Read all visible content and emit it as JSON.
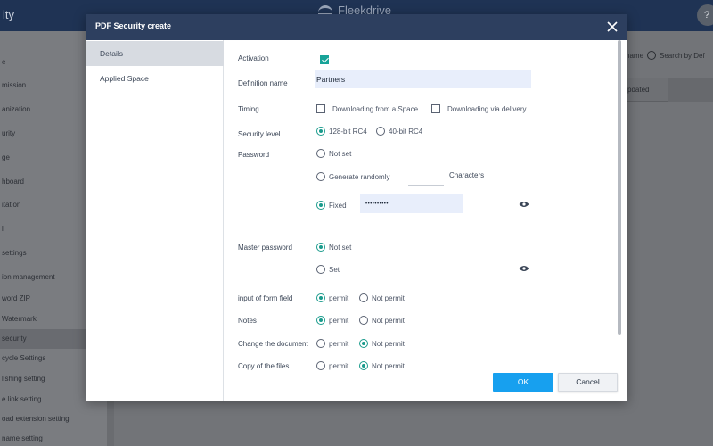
{
  "app": {
    "title_fragment": "ity",
    "logo_text": "Fleekdrive",
    "help_label": "?"
  },
  "sidebar": {
    "items": [
      {
        "label": "e"
      },
      {
        "label": "mission"
      },
      {
        "label": "anization"
      },
      {
        "label": "urity"
      },
      {
        "label": "ge"
      },
      {
        "label": "hboard"
      },
      {
        "label": "itation"
      },
      {
        "label": "l"
      },
      {
        "label": " settings"
      },
      {
        "label": "ion management"
      },
      {
        "label": "word ZIP"
      },
      {
        "label": "Watermark"
      },
      {
        "label": "security",
        "active": true
      },
      {
        "label": "cycle Settings"
      },
      {
        "label": "lishing setting"
      },
      {
        "label": "e link setting"
      },
      {
        "label": "oad extension setting"
      },
      {
        "label": " name setting"
      }
    ]
  },
  "background": {
    "search_option_1": "name",
    "search_option_2": "Search by Def",
    "column_header": "pdated"
  },
  "modal": {
    "title": "PDF Security create",
    "close_icon": "close-icon",
    "nav": [
      {
        "label": "Details",
        "active": true
      },
      {
        "label": "Applied Space",
        "active": false
      }
    ],
    "form": {
      "activation": {
        "label": "Activation",
        "checked": true
      },
      "definition_name": {
        "label": "Definition name",
        "value": "Partners"
      },
      "timing": {
        "label": "Timing",
        "options": [
          {
            "label": "Downloading from a Space",
            "checked": false
          },
          {
            "label": "Downloading via delivery",
            "checked": false
          }
        ]
      },
      "security_level": {
        "label": "Security level",
        "options": [
          {
            "label": "128-bit RC4",
            "selected": true
          },
          {
            "label": "40-bit RC4",
            "selected": false
          }
        ]
      },
      "password": {
        "label": "Password",
        "options": [
          {
            "label": "Not set",
            "selected": false
          },
          {
            "label": "Generate randomly",
            "selected": false
          },
          {
            "label": "Fixed",
            "selected": true
          }
        ],
        "characters_label": "Characters",
        "characters_value": "",
        "fixed_value": "••••••••••"
      },
      "master_password": {
        "label": "Master password",
        "options": [
          {
            "label": "Not set",
            "selected": true
          },
          {
            "label": "Set",
            "selected": false
          }
        ],
        "set_value": ""
      },
      "form_field": {
        "label": "input of form field",
        "options": [
          {
            "label": "permit",
            "selected": true
          },
          {
            "label": "Not permit",
            "selected": false
          }
        ]
      },
      "notes": {
        "label": "Notes",
        "options": [
          {
            "label": "permit",
            "selected": true
          },
          {
            "label": "Not permit",
            "selected": false
          }
        ]
      },
      "change_document": {
        "label": "Change the document",
        "options": [
          {
            "label": "permit",
            "selected": false
          },
          {
            "label": "Not permit",
            "selected": true
          }
        ]
      },
      "copy_files": {
        "label": "Copy of the files",
        "options": [
          {
            "label": "permit",
            "selected": false
          },
          {
            "label": "Not permit",
            "selected": true
          }
        ]
      }
    },
    "buttons": {
      "ok": "OK",
      "cancel": "Cancel"
    }
  },
  "colors": {
    "header": "#1f3354",
    "modal_header": "#2d3f5f",
    "accent": "#1a9b8c",
    "ok_button": "#17a0ef"
  }
}
